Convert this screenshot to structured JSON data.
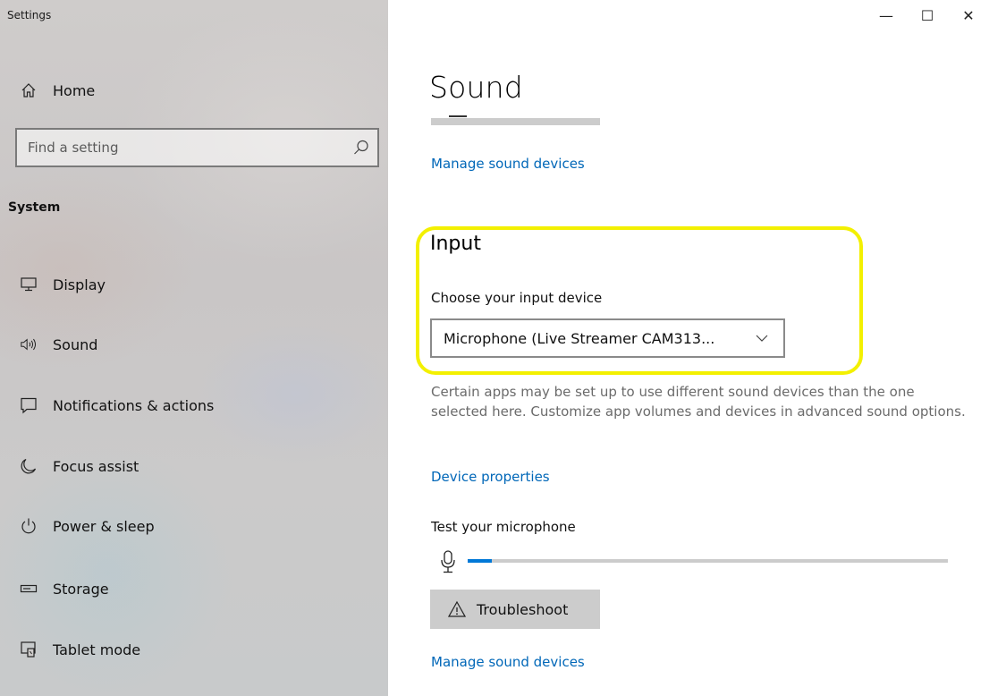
{
  "window": {
    "app_title": "Settings",
    "minimize_glyph": "—",
    "maximize_glyph": "☐",
    "close_glyph": "✕"
  },
  "sidebar": {
    "home_label": "Home",
    "search": {
      "placeholder": "Find a setting",
      "value": ""
    },
    "section_label": "System",
    "items": [
      {
        "label": "Display",
        "icon": "display-icon"
      },
      {
        "label": "Sound",
        "icon": "speaker-icon"
      },
      {
        "label": "Notifications & actions",
        "icon": "notification-icon"
      },
      {
        "label": "Focus assist",
        "icon": "moon-icon"
      },
      {
        "label": "Power & sleep",
        "icon": "power-icon"
      },
      {
        "label": "Storage",
        "icon": "storage-icon"
      },
      {
        "label": "Tablet mode",
        "icon": "tablet-mode-icon"
      }
    ]
  },
  "main": {
    "page_title": "Sound",
    "manage_link_top": "Manage sound devices",
    "input": {
      "heading": "Input",
      "device_label": "Choose your input device",
      "device_value": "Microphone (Live Streamer CAM313...",
      "help_text": "Certain apps may be set up to use different sound devices than the one selected here. Customize app volumes and devices in advanced sound options.",
      "device_properties_link": "Device properties",
      "test_label": "Test your microphone",
      "mic_level_percent": 5,
      "troubleshoot_label": "Troubleshoot",
      "manage_link_bottom": "Manage sound devices"
    },
    "colors": {
      "accent": "#0078d7",
      "link": "#0067b8",
      "highlight": "#f3f000"
    }
  }
}
